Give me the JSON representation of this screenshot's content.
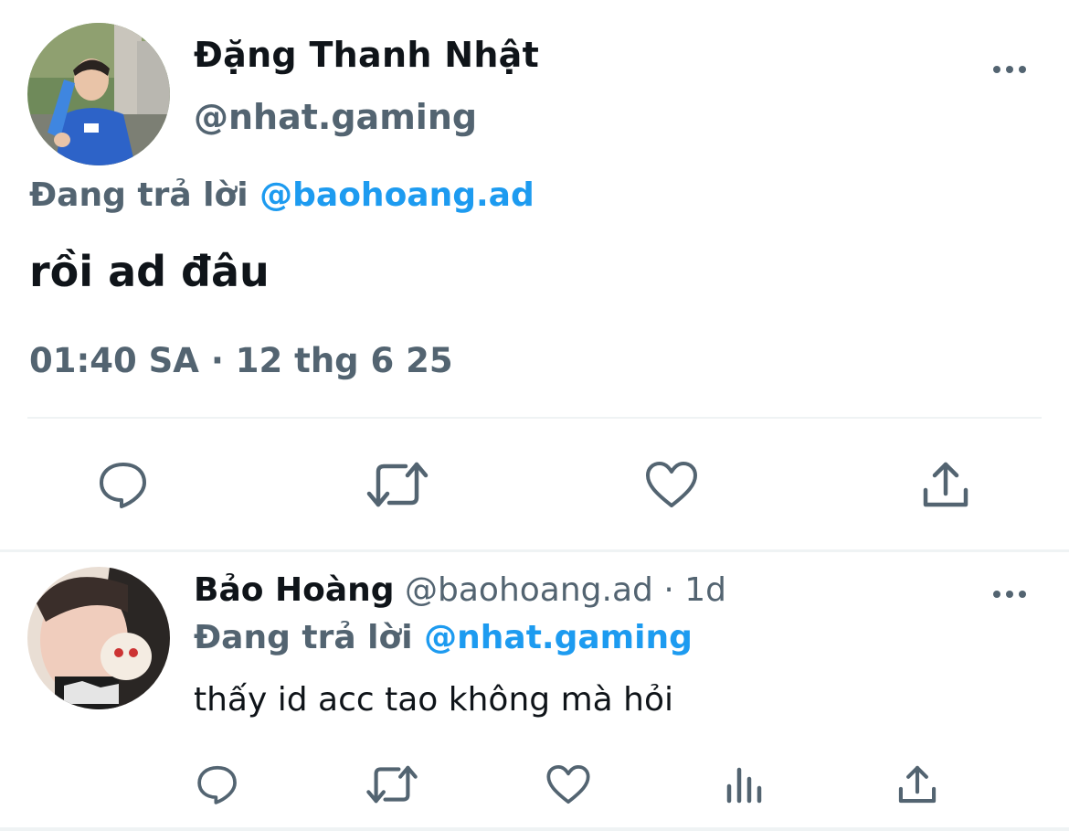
{
  "colors": {
    "text": "#0f1419",
    "secondary": "#536471",
    "accent": "#1d9bf0",
    "divider": "#eff3f4"
  },
  "main_tweet": {
    "author_name": "Đặng Thanh Nhật",
    "author_handle": "@nhat.gaming",
    "replying_label": "Đang trả lời",
    "replying_to": "@baohoang.ad",
    "text": "rồi ad đâu",
    "timestamp": "01:40 SA · 12 thg 6 25",
    "more_icon": "more-horizontal-icon",
    "actions": [
      {
        "name": "reply",
        "icon": "reply-icon"
      },
      {
        "name": "retweet",
        "icon": "retweet-icon"
      },
      {
        "name": "like",
        "icon": "heart-icon"
      },
      {
        "name": "share",
        "icon": "share-icon"
      }
    ]
  },
  "reply_tweet": {
    "author_name": "Bảo Hoàng",
    "author_handle": "@baohoang.ad",
    "separator": "·",
    "time_ago": "1d",
    "replying_label": "Đang trả lời",
    "replying_to": "@nhat.gaming",
    "text": "thấy id acc tao không mà hỏi",
    "more_icon": "more-horizontal-icon",
    "actions": [
      {
        "name": "reply",
        "icon": "reply-icon"
      },
      {
        "name": "retweet",
        "icon": "retweet-icon"
      },
      {
        "name": "like",
        "icon": "heart-icon"
      },
      {
        "name": "views",
        "icon": "analytics-icon"
      },
      {
        "name": "share",
        "icon": "share-icon"
      }
    ]
  }
}
